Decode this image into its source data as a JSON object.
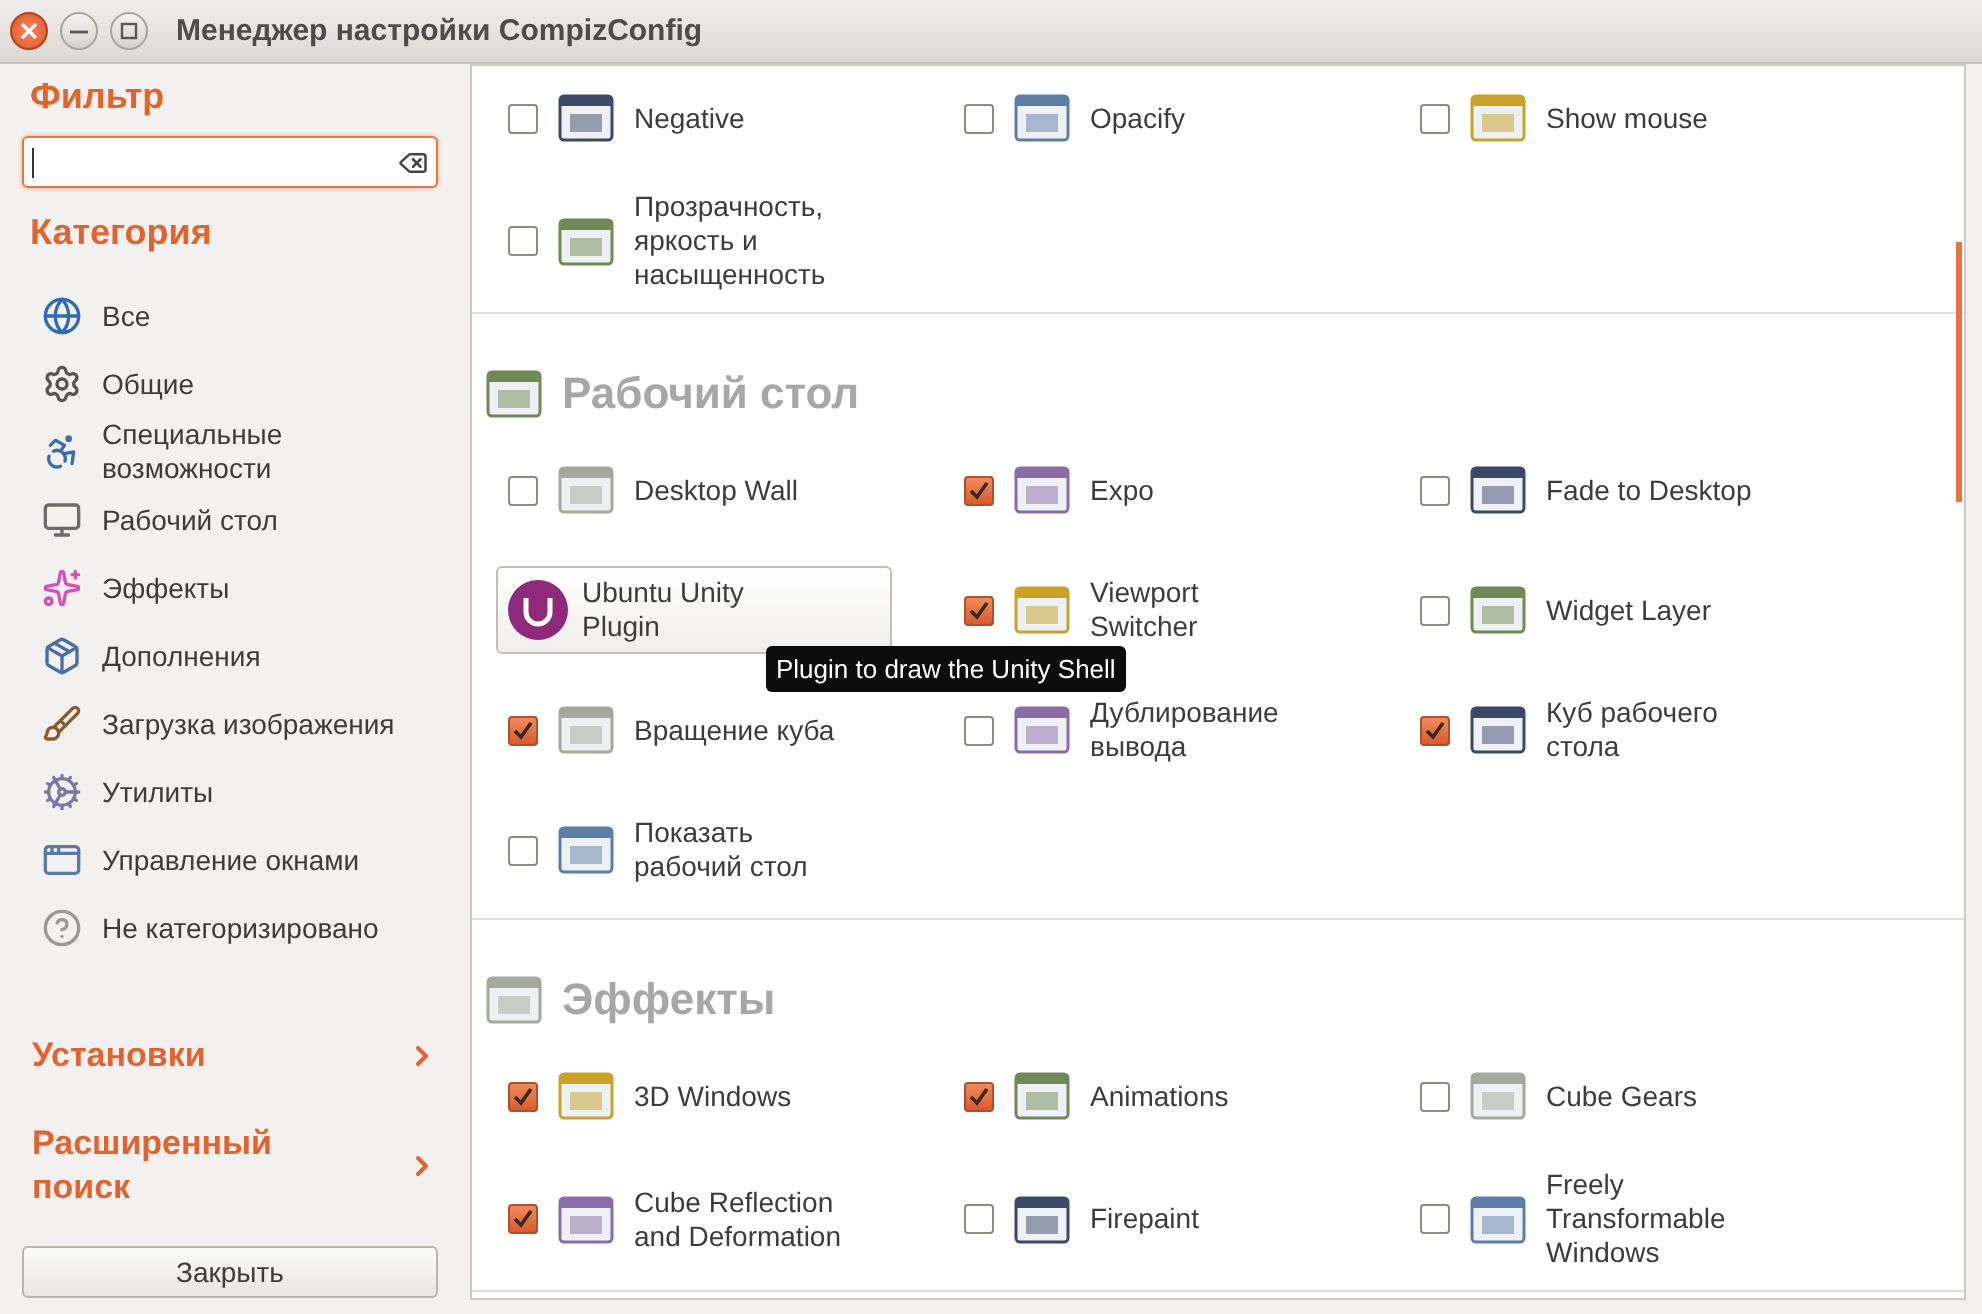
{
  "window": {
    "title": "Менеджер настройки CompizConfig"
  },
  "sidebar": {
    "filter_heading": "Фильтр",
    "category_heading": "Категория",
    "categories": [
      {
        "label": "Все"
      },
      {
        "label": "Общие"
      },
      {
        "label": "Специальные\nвозможности"
      },
      {
        "label": "Рабочий стол"
      },
      {
        "label": "Эффекты"
      },
      {
        "label": "Дополнения"
      },
      {
        "label": "Загрузка изображения"
      },
      {
        "label": "Утилиты"
      },
      {
        "label": "Управление окнами"
      },
      {
        "label": "Не категоризировано"
      }
    ],
    "sections": [
      {
        "label": "Установки"
      },
      {
        "label": "Расширенный\nпоиск"
      }
    ],
    "close_button": "Закрыть"
  },
  "groups": [
    {
      "items": [
        {
          "label": "Negative",
          "checked": false
        },
        {
          "label": "Opacify",
          "checked": false
        },
        {
          "label": "Show mouse",
          "checked": false
        },
        {
          "label": "Прозрачность,\nяркость и\nнасыщенность",
          "checked": false
        }
      ]
    },
    {
      "title": "Рабочий стол",
      "items": [
        {
          "label": "Desktop Wall",
          "checked": false
        },
        {
          "label": "Expo",
          "checked": true
        },
        {
          "label": "Fade to Desktop",
          "checked": false
        },
        {
          "label": "Ubuntu Unity\nPlugin",
          "hovered": true
        },
        {
          "label": "Viewport\nSwitcher",
          "checked": true
        },
        {
          "label": "Widget Layer",
          "checked": false
        },
        {
          "label": "Вращение куба",
          "checked": true
        },
        {
          "label": "Дублирование\nвывода",
          "checked": false
        },
        {
          "label": "Куб рабочего\nстола",
          "checked": true
        },
        {
          "label": "Показать\nрабочий стол",
          "checked": false
        }
      ]
    },
    {
      "title": "Эффекты",
      "items": [
        {
          "label": "3D Windows",
          "checked": true
        },
        {
          "label": "Animations",
          "checked": true
        },
        {
          "label": "Cube Gears",
          "checked": false
        },
        {
          "label": "Cube Reflection\nand Deformation",
          "checked": true
        },
        {
          "label": "Firepaint",
          "checked": false
        },
        {
          "label": "Freely\nTransformable\nWindows",
          "checked": false
        }
      ]
    }
  ],
  "tooltip": "Plugin to draw the Unity Shell"
}
